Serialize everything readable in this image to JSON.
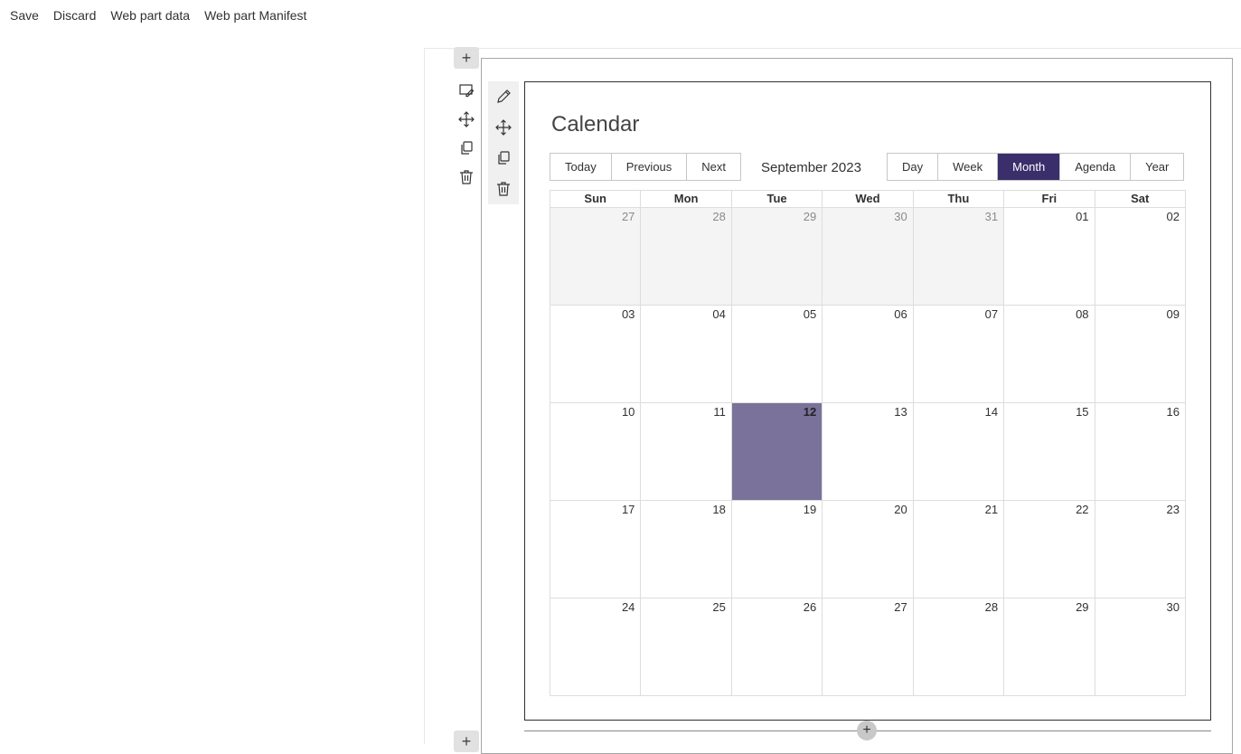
{
  "topbar": {
    "save": "Save",
    "discard": "Discard",
    "web_part_data": "Web part data",
    "web_part_manifest": "Web part Manifest"
  },
  "icons": {
    "add": "+",
    "section_tools": [
      "edit-section-icon",
      "move-icon",
      "duplicate-icon",
      "delete-icon"
    ],
    "webpart_tools": [
      "edit-pencil-icon",
      "move-icon",
      "duplicate-icon",
      "delete-icon"
    ]
  },
  "calendar": {
    "title": "Calendar",
    "nav": {
      "today": "Today",
      "previous": "Previous",
      "next": "Next"
    },
    "period": "September 2023",
    "views": {
      "day": "Day",
      "week": "Week",
      "month": "Month",
      "agenda": "Agenda",
      "year": "Year"
    },
    "active_view": "Month",
    "weekdays": [
      "Sun",
      "Mon",
      "Tue",
      "Wed",
      "Thu",
      "Fri",
      "Sat"
    ],
    "weeks": [
      [
        "27",
        "28",
        "29",
        "30",
        "31",
        "01",
        "02"
      ],
      [
        "03",
        "04",
        "05",
        "06",
        "07",
        "08",
        "09"
      ],
      [
        "10",
        "11",
        "12",
        "13",
        "14",
        "15",
        "16"
      ],
      [
        "17",
        "18",
        "19",
        "20",
        "21",
        "22",
        "23"
      ],
      [
        "24",
        "25",
        "26",
        "27",
        "28",
        "29",
        "30"
      ]
    ],
    "off_range_days_first_week": 5,
    "today": "12",
    "colors": {
      "active_view": "#3b2f6b",
      "today_cell": "#7a729b",
      "off_range": "#f4f4f4"
    }
  }
}
